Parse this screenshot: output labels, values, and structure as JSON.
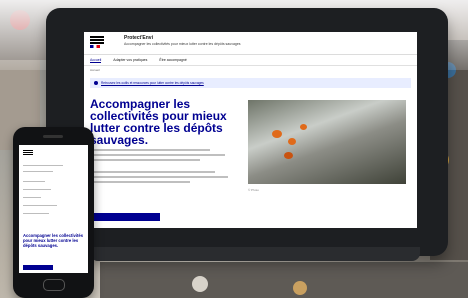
{
  "site": {
    "title": "Protect'Envi",
    "tagline": "Accompagner les collectivités pour mieux lutter contre les dépôts sauvages"
  },
  "nav": {
    "items": [
      {
        "label": "Accueil"
      },
      {
        "label": "Adapter vos pratiques"
      },
      {
        "label": "Être accompagné"
      }
    ]
  },
  "breadcrumb": "Accueil",
  "notice": {
    "text": "Retrouvez les outils et ressources pour lutter contre les dépôts sauvages"
  },
  "hero": {
    "title": "Accompagner les collectivités pour mieux lutter contre les dépôts sauvages.",
    "photo_caption": "© Photo"
  },
  "phone": {
    "hero_title": "Accompagner les collectivités pour mieux lutter contre les dépôts sauvages."
  }
}
